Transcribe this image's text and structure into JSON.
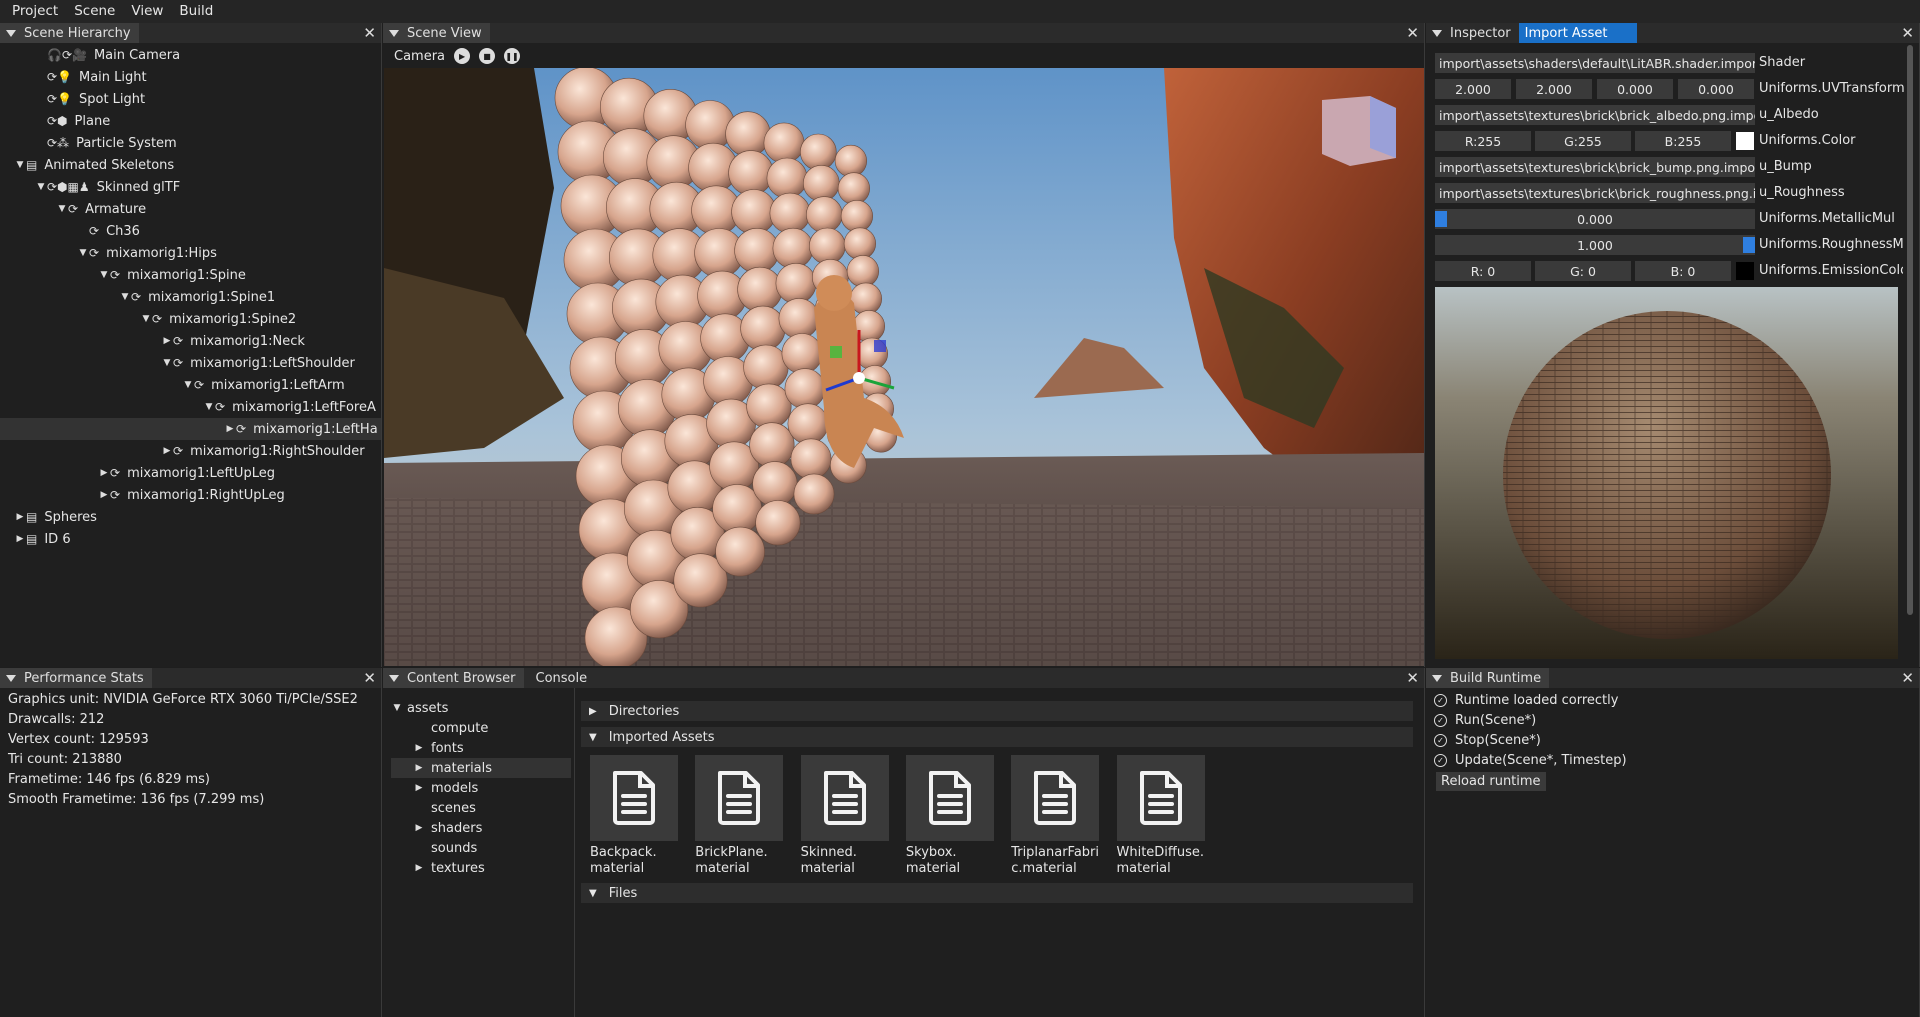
{
  "menu": [
    "Project",
    "Scene",
    "View",
    "Build"
  ],
  "hierarchy": {
    "tab": "Scene Hierarchy",
    "items": [
      {
        "label": "Main Camera",
        "depth": 1,
        "arrow": "",
        "icons": "🎧⟳🎥"
      },
      {
        "label": "Main Light",
        "depth": 1,
        "arrow": "",
        "icons": "⟳💡"
      },
      {
        "label": "Spot Light",
        "depth": 1,
        "arrow": "",
        "icons": "⟳💡"
      },
      {
        "label": "Plane",
        "depth": 1,
        "arrow": "",
        "icons": "⟳⬢"
      },
      {
        "label": "Particle System",
        "depth": 1,
        "arrow": "",
        "icons": "⟳⁂"
      },
      {
        "label": "Animated Skeletons",
        "depth": 0,
        "arrow": "▼",
        "icons": "▤"
      },
      {
        "label": "Skinned glTF",
        "depth": 1,
        "arrow": "▼",
        "icons": "⟳⬢▦♟"
      },
      {
        "label": "Armature",
        "depth": 2,
        "arrow": "▼",
        "icons": "⟳"
      },
      {
        "label": "Ch36",
        "depth": 3,
        "arrow": "",
        "icons": "⟳"
      },
      {
        "label": "mixamorig1:Hips",
        "depth": 3,
        "arrow": "▼",
        "icons": "⟳"
      },
      {
        "label": "mixamorig1:Spine",
        "depth": 4,
        "arrow": "▼",
        "icons": "⟳"
      },
      {
        "label": "mixamorig1:Spine1",
        "depth": 5,
        "arrow": "▼",
        "icons": "⟳"
      },
      {
        "label": "mixamorig1:Spine2",
        "depth": 6,
        "arrow": "▼",
        "icons": "⟳"
      },
      {
        "label": "mixamorig1:Neck",
        "depth": 7,
        "arrow": "▶",
        "icons": "⟳"
      },
      {
        "label": "mixamorig1:LeftShoulder",
        "depth": 7,
        "arrow": "▼",
        "icons": "⟳"
      },
      {
        "label": "mixamorig1:LeftArm",
        "depth": 8,
        "arrow": "▼",
        "icons": "⟳"
      },
      {
        "label": "mixamorig1:LeftForeA",
        "depth": 9,
        "arrow": "▼",
        "icons": "⟳"
      },
      {
        "label": "mixamorig1:LeftHa",
        "depth": 10,
        "arrow": "▶",
        "icons": "⟳",
        "highlight": true
      },
      {
        "label": "mixamorig1:RightShoulder",
        "depth": 7,
        "arrow": "▶",
        "icons": "⟳"
      },
      {
        "label": "mixamorig1:LeftUpLeg",
        "depth": 4,
        "arrow": "▶",
        "icons": "⟳"
      },
      {
        "label": "mixamorig1:RightUpLeg",
        "depth": 4,
        "arrow": "▶",
        "icons": "⟳"
      },
      {
        "label": "Spheres",
        "depth": 0,
        "arrow": "▶",
        "icons": "▤"
      },
      {
        "label": "ID 6",
        "depth": 0,
        "arrow": "▶",
        "icons": "▤"
      }
    ]
  },
  "scene_view": {
    "tab": "Scene View",
    "camera_label": "Camera"
  },
  "inspector": {
    "tabs": [
      "Inspector",
      "Import Asset"
    ],
    "shader_path": "import\\assets\\shaders\\default\\LitABR.shader.import",
    "shader_label": "Shader",
    "uv": [
      "2.000",
      "2.000",
      "0.000",
      "0.000"
    ],
    "uv_label": "Uniforms.UVTransform",
    "albedo_path": "import\\assets\\textures\\brick\\brick_albedo.png.import",
    "albedo_label": "u_Albedo",
    "color": [
      "R:255",
      "G:255",
      "B:255"
    ],
    "color_label": "Uniforms.Color",
    "bump_path": "import\\assets\\textures\\brick\\brick_bump.png.import",
    "bump_label": "u_Bump",
    "rough_path": "import\\assets\\textures\\brick\\brick_roughness.png.import",
    "rough_label": "u_Roughness",
    "metallic": "0.000",
    "metallic_value": 0.0,
    "metallic_label": "Uniforms.MetallicMul",
    "roughness": "1.000",
    "roughness_value": 1.0,
    "roughness_label": "Uniforms.RoughnessMul",
    "emission": [
      "R:  0",
      "G:  0",
      "B:  0"
    ],
    "emission_label": "Uniforms.EmissionColor"
  },
  "perf": {
    "tab": "Performance Stats",
    "lines": [
      "Graphics unit: NVIDIA GeForce RTX 3060 Ti/PCIe/SSE2",
      "Drawcalls: 212",
      "Vertex count: 129593",
      "Tri count: 213880",
      "Frametime: 146 fps (6.829 ms)",
      "Smooth Frametime: 136 fps (7.299 ms)"
    ]
  },
  "content": {
    "tabs": [
      "Content Browser",
      "Console"
    ],
    "root": "assets",
    "folders": [
      {
        "label": "compute",
        "arrow": ""
      },
      {
        "label": "fonts",
        "arrow": "▶"
      },
      {
        "label": "materials",
        "arrow": "▶",
        "selected": true
      },
      {
        "label": "models",
        "arrow": "▶"
      },
      {
        "label": "scenes",
        "arrow": ""
      },
      {
        "label": "shaders",
        "arrow": "▶"
      },
      {
        "label": "sounds",
        "arrow": ""
      },
      {
        "label": "textures",
        "arrow": "▶"
      }
    ],
    "sections": {
      "directories": "Directories",
      "imported": "Imported Assets",
      "files": "Files"
    },
    "assets": [
      {
        "line1": "Backpack.",
        "line2": "material"
      },
      {
        "line1": "BrickPlane.",
        "line2": "material"
      },
      {
        "line1": "Skinned.",
        "line2": "material"
      },
      {
        "line1": "Skybox.",
        "line2": "material"
      },
      {
        "line1": "TriplanarFabri",
        "line2": "c.material"
      },
      {
        "line1": "WhiteDiffuse.",
        "line2": "material"
      }
    ]
  },
  "build": {
    "tab": "Build Runtime",
    "checks": [
      "Runtime loaded correctly",
      "Run(Scene*)",
      "Stop(Scene*)",
      "Update(Scene*, Timestep)"
    ],
    "reload": "Reload runtime"
  }
}
